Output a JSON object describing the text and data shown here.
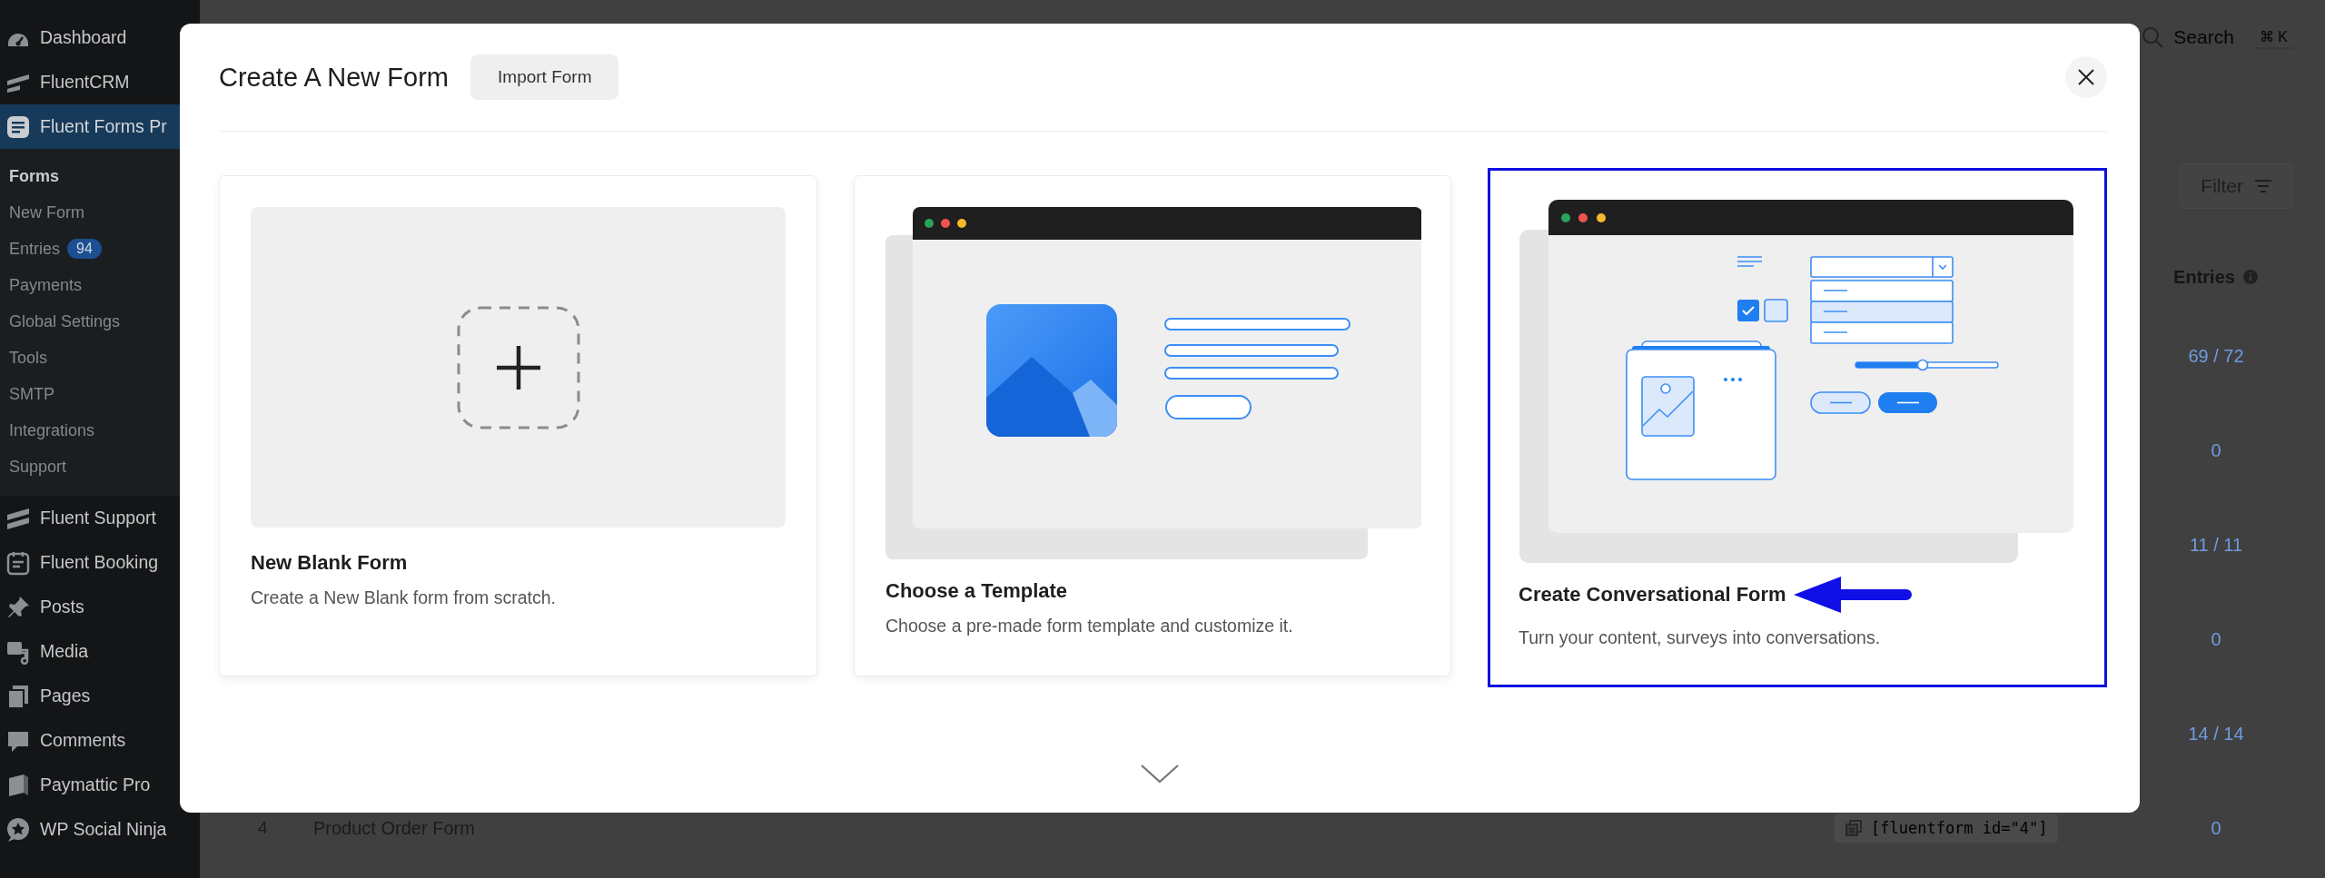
{
  "sidebar": {
    "items": [
      {
        "label": "Dashboard",
        "selected": false
      },
      {
        "label": "FluentCRM",
        "selected": false
      },
      {
        "label": "Fluent Forms Pr",
        "selected": true,
        "children": [
          {
            "label": "Forms",
            "selected": true
          },
          {
            "label": "New Form",
            "selected": false
          },
          {
            "label": "Entries",
            "selected": false,
            "badge": "94"
          },
          {
            "label": "Payments",
            "selected": false
          },
          {
            "label": "Global Settings",
            "selected": false
          },
          {
            "label": "Tools",
            "selected": false
          },
          {
            "label": "SMTP",
            "selected": false
          },
          {
            "label": "Integrations",
            "selected": false
          },
          {
            "label": "Support",
            "selected": false
          }
        ]
      },
      {
        "label": "Fluent Support",
        "selected": false
      },
      {
        "label": "Fluent Booking",
        "selected": false
      },
      {
        "label": "Posts",
        "selected": false
      },
      {
        "label": "Media",
        "selected": false
      },
      {
        "label": "Pages",
        "selected": false
      },
      {
        "label": "Comments",
        "selected": false
      },
      {
        "label": "Paymattic Pro",
        "selected": false
      },
      {
        "label": "WP Social Ninja",
        "selected": false
      }
    ]
  },
  "page": {
    "search": {
      "label": "Search",
      "shortcut": "⌘ K"
    },
    "filter_button": "Filter",
    "table": {
      "columns": [
        "Entries"
      ],
      "rows": [
        {
          "entries": "69 / 72"
        },
        {
          "entries": "0"
        },
        {
          "entries": "11 / 11"
        },
        {
          "entries": "0"
        },
        {
          "entries": "14 / 14"
        },
        {
          "number": "4",
          "title": "Product Order Form",
          "shortcode": "[fluentform id=\"4\"]",
          "entries": "0"
        }
      ]
    }
  },
  "modal": {
    "title": "Create A New Form",
    "import_button": "Import Form",
    "options": [
      {
        "kind": "blank",
        "title": "New Blank Form",
        "description": "Create a New Blank form from scratch.",
        "selected": false,
        "annotated": false
      },
      {
        "kind": "template",
        "title": "Choose a Template",
        "description": "Choose a pre-made form template and customize it.",
        "selected": false,
        "annotated": false
      },
      {
        "kind": "conversational",
        "title": "Create Conversational Form",
        "description": "Turn your content, surveys into conversations.",
        "selected": true,
        "annotated": true
      }
    ]
  }
}
